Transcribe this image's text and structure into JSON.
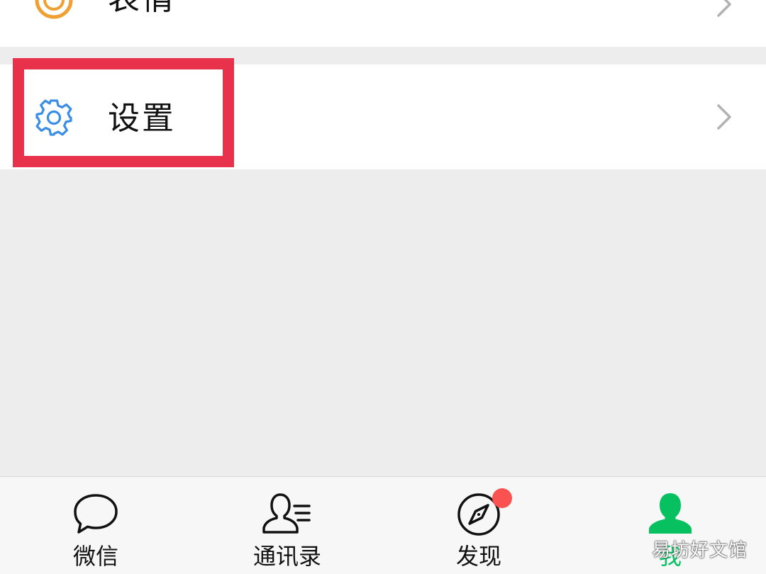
{
  "menu": {
    "emoji": {
      "label": "表情",
      "icon": "emoji-icon",
      "icon_color": "#f0a032"
    },
    "settings": {
      "label": "设置",
      "icon": "gear-icon",
      "icon_color": "#3a8ee6"
    }
  },
  "highlight": {
    "color": "#e8324c"
  },
  "tabbar": {
    "tabs": [
      {
        "label": "微信",
        "icon": "chat-bubble-icon"
      },
      {
        "label": "通讯录",
        "icon": "contacts-icon"
      },
      {
        "label": "发现",
        "icon": "compass-icon",
        "badge": true
      },
      {
        "label": "我",
        "icon": "person-icon",
        "active": true
      }
    ],
    "active_color": "#07c160",
    "badge_color": "#fa5151"
  },
  "watermark": {
    "text": "易坊好文馆"
  }
}
